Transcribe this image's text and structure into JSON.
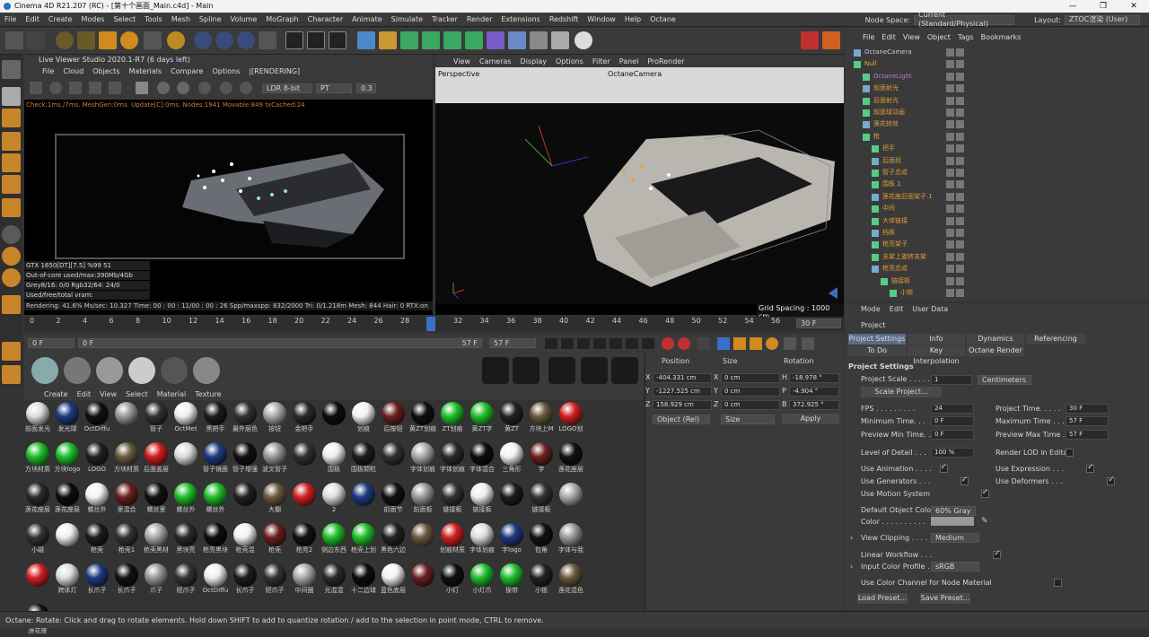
{
  "window": {
    "title": "Cinema 4D R21.207 (RC) - [第十个画面_Main.c4d] - Main",
    "controls": [
      "—",
      "❐",
      "✕"
    ]
  },
  "menu": {
    "items": [
      "File",
      "Edit",
      "Create",
      "Modes",
      "Select",
      "Tools",
      "Mesh",
      "Spline",
      "Volume",
      "MoGraph",
      "Character",
      "Animate",
      "Simulate",
      "Tracker",
      "Render",
      "Extensions",
      "Redshift",
      "Window",
      "Help",
      "Octane"
    ],
    "node_space_label": "Node Space:",
    "node_space_value": "Current (Standard/Physical)",
    "layout_label": "Layout:",
    "layout_value": "ZTOC渲染 (User)"
  },
  "live_viewer": {
    "title": "Live Viewer Studio 2020.1-R7 (6 days left)",
    "menu": [
      "File",
      "Cloud",
      "Objects",
      "Materials",
      "Compare",
      "Options",
      "|[RENDERING]"
    ],
    "ldr": "LDR 8-bit",
    "pt": "PT",
    "val": "0.3",
    "status": "Check:1ms./7ms. MeshGen:0ms. Update[C]:0ms. Nodes:1941 Movable:849 txCached:24",
    "gpu": "GTX 1650[DT][7.5]    %99    51",
    "ooc": "Out-of-core used/max:390Mb/4Gb",
    "grey": "Grey8/16: 0/0       Rgb32/64: 24/0",
    "vram": "Used/free/total vram: 1.586Gb/535Mb/4Gb",
    "render": "Rendering: 41.6%   Ms/sec: 10.327   Time: 00 : 00 : 11/00 : 00 : 26   Spp/maxspp: 832/2000   Tri: 0/1.218m  Mesh: 844  Hair: 0   RTX:on"
  },
  "viewport": {
    "menu": [
      "View",
      "Cameras",
      "Display",
      "Options",
      "Filter",
      "Panel",
      "ProRender"
    ],
    "label": "Perspective",
    "camera": "OctaneCamera",
    "grid": "Grid Spacing : 1000 cm"
  },
  "timeline": {
    "ticks": [
      "0",
      "2",
      "4",
      "6",
      "8",
      "10",
      "12",
      "14",
      "16",
      "18",
      "20",
      "22",
      "24",
      "26",
      "28",
      "30",
      "32",
      "34",
      "36",
      "38",
      "40",
      "42",
      "44",
      "46",
      "48",
      "50",
      "52",
      "54",
      "56"
    ],
    "end": "30 F",
    "current": "0 F",
    "start": "0 F",
    "end_frame": "57 F",
    "max": "57 F"
  },
  "materials": {
    "menu": [
      "Create",
      "Edit",
      "View",
      "Select",
      "Material",
      "Texture"
    ],
    "items": [
      "前面发光",
      "发光球",
      "OctDiffu",
      "",
      "管子",
      "OctMet",
      "黑把手",
      "最外层色",
      "按钮",
      "金把手",
      "",
      "划痕",
      "后按钮",
      "黄ZT划痕",
      "ZT划痕",
      "黄ZT字",
      "黄ZT",
      "方块上M",
      "LOGO划",
      "方块材质",
      "方块logo",
      "LOGO",
      "方块材质",
      "后面盖层",
      "",
      "管子镜面",
      "管子增强",
      "波叉管子",
      "",
      "围板",
      "围板颗粒",
      "",
      "字体划痕",
      "字体划痕",
      "字体混合",
      "三角形",
      "字",
      "莲花座层",
      "莲花座层",
      "莲花座层",
      "螺丝外",
      "里混合",
      "螺丝里",
      "螺丝外",
      "螺丝外",
      "",
      "大棚",
      "",
      "2",
      "",
      "前面节",
      "前面板",
      "链接板",
      "链接板",
      "",
      "链接板",
      "",
      "小磁",
      "",
      "枪壳",
      "枪壳1",
      "枪壳黑材",
      "黑块亮",
      "枪亮黑块",
      "枪壳混",
      "枪壳",
      "枪亮2",
      "侧边东西",
      "枪壳上划",
      "黑色六边",
      "",
      "划痕材质",
      "字体划痕",
      "字logo",
      "包角",
      "字体与我",
      "",
      "跨体灯",
      "长爪子",
      "长爪子",
      "爪子",
      "短爪子",
      "OctDiffu",
      "长爪子",
      "短爪子",
      "中间圈",
      "光混混",
      "十二边球",
      "蓝色底层",
      "",
      "小灯",
      "小灯爪",
      "操带",
      "小锁",
      "莲花混色",
      "莲花座"
    ]
  },
  "coords": {
    "headers": [
      "Position",
      "Size",
      "Rotation"
    ],
    "rows": [
      {
        "axis": "X",
        "pos": "-404.331 cm",
        "saxis": "X",
        "size": "0 cm",
        "raxis": "H",
        "rot": "-18.978 °"
      },
      {
        "axis": "Y",
        "pos": "-1227.525 cm",
        "saxis": "Y",
        "size": "0 cm",
        "raxis": "P",
        "rot": "-4.904 °"
      },
      {
        "axis": "Z",
        "pos": "158.929 cm",
        "saxis": "Z",
        "size": "0 cm",
        "raxis": "B",
        "rot": "372.925 °"
      }
    ],
    "mode": "Object (Rel)",
    "size_mode": "Size",
    "apply": "Apply"
  },
  "objects": {
    "menu": [
      "File",
      "Edit",
      "View",
      "Object",
      "Tags",
      "Bookmarks"
    ],
    "rows": [
      {
        "name": "OctaneCamera",
        "indent": 0,
        "color": "#ccc"
      },
      {
        "name": "Null",
        "indent": 0,
        "color": "#e0b030"
      },
      {
        "name": "OctaneLight",
        "indent": 1,
        "color": "#b080d0"
      },
      {
        "name": "前面射光",
        "indent": 1
      },
      {
        "name": "后面射光",
        "indent": 1
      },
      {
        "name": "前面球动画",
        "indent": 1
      },
      {
        "name": "莲花转效",
        "indent": 1
      },
      {
        "name": "枪",
        "indent": 1
      },
      {
        "name": "把手",
        "indent": 2
      },
      {
        "name": "后面段",
        "indent": 2
      },
      {
        "name": "管子总成",
        "indent": 2
      },
      {
        "name": "围板.1",
        "indent": 2
      },
      {
        "name": "莲花座后面架子.1",
        "indent": 2
      },
      {
        "name": "中间",
        "indent": 2
      },
      {
        "name": "大体链接",
        "indent": 2
      },
      {
        "name": "档板",
        "indent": 2
      },
      {
        "name": "枪亮架子",
        "indent": 2
      },
      {
        "name": "支架上旋转支架",
        "indent": 2
      },
      {
        "name": "枪亮总成",
        "indent": 2
      },
      {
        "name": "链接板",
        "indent": 3
      },
      {
        "name": "小锁",
        "indent": 4
      }
    ]
  },
  "attributes": {
    "menu": [
      "Mode",
      "Edit",
      "User Data"
    ],
    "object": "Project",
    "tabs1": [
      "Project Settings",
      "Info",
      "Dynamics",
      "Referencing"
    ],
    "tabs2": [
      "To Do",
      "Key Interpolation",
      "Octane Render"
    ],
    "section": "Project Settings",
    "scale_label": "Project Scale . . . . .",
    "scale_value": "1",
    "scale_unit": "Centimeters",
    "scale_button": "Scale Project...",
    "fps_label": "FPS . . . . . . . . .",
    "fps": "24",
    "ptime_label": "Project Time. . . . .",
    "ptime": "30 F",
    "mintime_label": "Minimum Time. . .",
    "mintime": "0 F",
    "maxtime_label": "Maximum Time . . .",
    "maxtime": "57 F",
    "pmin_label": "Preview Min Time. .",
    "pmin": "0 F",
    "pmax_label": "Preview Max Time .",
    "pmax": "57 F",
    "lod_label": "Level of Detail . . .",
    "lod": "100 %",
    "rlod_label": "Render LOD in Editor",
    "anim_label": "Use Animation . . . .",
    "expr_label": "Use Expression . . .",
    "gen_label": "Use Generators . . .",
    "def_label": "Use Deformers . . .",
    "motion_label": "Use Motion System",
    "doc_label": "Default Object Color",
    "doc_value": "60% Gray",
    "color_label": "Color . . . . . . . . . .",
    "clip_label": "View Clipping . . . . . .",
    "clip_value": "Medium",
    "lw_label": "Linear Workflow . . .",
    "icp_label": "Input Color Profile . .",
    "icp_value": "sRGB",
    "ucc_label": "Use Color Channel for Node Material",
    "load": "Load Preset...",
    "save": "Save Preset..."
  },
  "status": "Octane:     Rotate: Click and drag to rotate elements. Hold down SHIFT to add to quantize rotation / add to the selection in point mode, CTRL to remove."
}
